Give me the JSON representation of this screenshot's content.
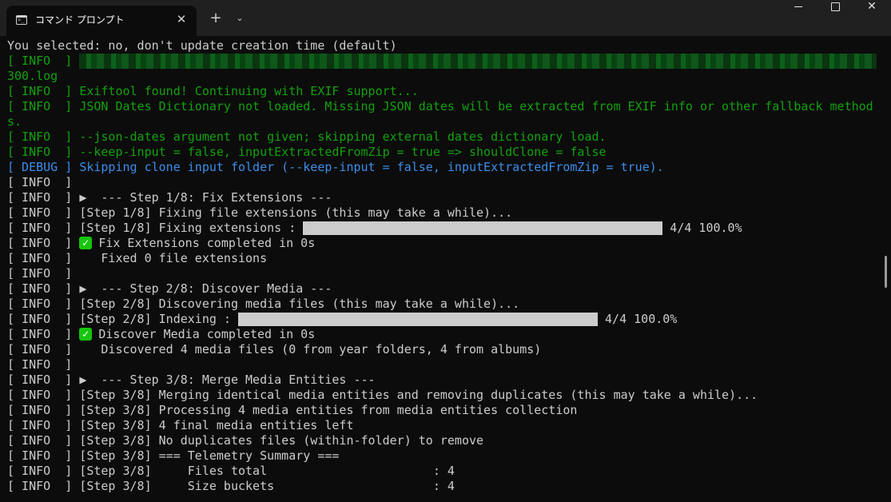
{
  "titlebar": {
    "tab_title": "コマンド プロンプト",
    "tab_close": "✕",
    "new_tab": "+",
    "dropdown": "⌄",
    "close": "✕"
  },
  "terminal": {
    "line_selected": "You selected: no, don't update creation time (default)",
    "info_tag": "[ INFO  ] ",
    "info_tag_bare": "[ INFO  ]",
    "debug_tag": "[ DEBUG ] ",
    "log_suffix": "300.log",
    "exiftool": "Exiftool found! Continuing with EXIF support...",
    "json_dict_a": "JSON Dates Dictionary not loaded. Missing JSON dates will be extracted from EXIF info or other fallback method",
    "json_dict_b": "s.",
    "json_dates_arg": "--json-dates argument not given; skipping external dates dictionary load.",
    "keep_input": "--keep-input = false, inputExtractedFromZip = true => shouldClone = false",
    "debug_skip": "Skipping clone input folder (--keep-input = false, inputExtractedFromZip = true).",
    "step1_header": "▶  --- Step 1/8: Fix Extensions ---",
    "step1_fixing": "[Step 1/8] Fixing file extensions (this may take a while)...",
    "step1_progress_label": "[Step 1/8] Fixing extensions : ",
    "step1_progress_value": " 4/4 100.0%",
    "step1_done": "Fix Extensions completed in 0s",
    "step1_fixed": "   Fixed 0 file extensions",
    "step2_header": "▶  --- Step 2/8: Discover Media ---",
    "step2_discovering": "[Step 2/8] Discovering media files (this may take a while)...",
    "step2_progress_label": "[Step 2/8] Indexing : ",
    "step2_progress_value": " 4/4 100.0%",
    "step2_done": "Discover Media completed in 0s",
    "step2_discovered": "   Discovered 4 media files (0 from year folders, 4 from albums)",
    "step3_header": "▶  --- Step 3/8: Merge Media Entities ---",
    "step3_merging": "[Step 3/8] Merging identical media entities and removing duplicates (this may take a while)...",
    "step3_processing": "[Step 3/8] Processing 4 media entities from media entities collection",
    "step3_final": "[Step 3/8] 4 final media entities left",
    "step3_nodup": "[Step 3/8] No duplicates files (within-folder) to remove",
    "step3_telemetry": "[Step 3/8] === Telemetry Summary ===",
    "step3_files_total": "[Step 3/8]     Files total                       : 4",
    "step3_size_buckets": "[Step 3/8]     Size buckets                      : 4",
    "check_glyph": "✓",
    "progress_1": 1.0,
    "progress_2": 1.0
  },
  "colors": {
    "background": "#0c0c0c",
    "text_default": "#cccccc",
    "text_info_green": "#13a10e",
    "text_debug_blue": "#3b8eea",
    "check_green": "#16c60c"
  }
}
